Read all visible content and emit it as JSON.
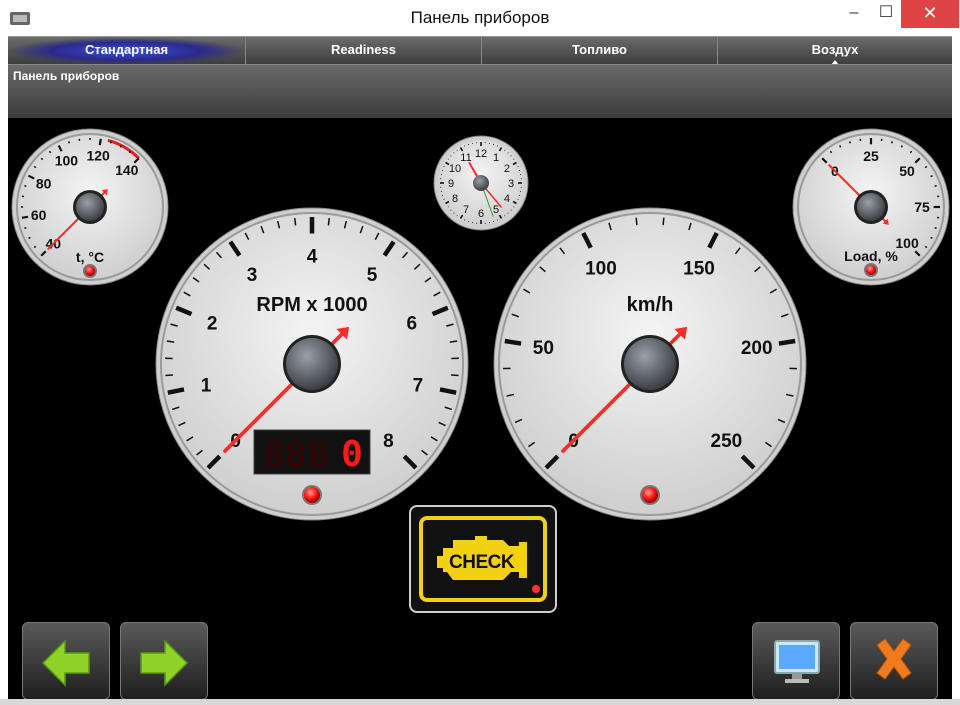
{
  "window": {
    "title": "Панель приборов",
    "icon": "app-icon",
    "minimize_label": "–",
    "maximize_label": "☐",
    "close_label": "✕"
  },
  "tabs": [
    {
      "label": "Стандартная",
      "active": true
    },
    {
      "label": "Readiness",
      "active": false
    },
    {
      "label": "Топливо",
      "active": false
    },
    {
      "label": "Воздух",
      "active": false
    }
  ],
  "subheader": {
    "label": "Панель приборов"
  },
  "gauges": {
    "temperature": {
      "label": "t, °C",
      "ticks": [
        "40",
        "60",
        "80",
        "100",
        "120",
        "140"
      ],
      "value": 40
    },
    "clock": {
      "ticks": [
        "12",
        "1",
        "2",
        "3",
        "4",
        "5",
        "6",
        "7",
        "8",
        "9",
        "10",
        "11"
      ]
    },
    "load": {
      "label": "Load, %",
      "ticks": [
        "0",
        "25",
        "50",
        "75",
        "100"
      ],
      "value": 0
    },
    "rpm": {
      "label": "RPM x 1000",
      "ticks": [
        "0",
        "1",
        "2",
        "3",
        "4",
        "5",
        "6",
        "7",
        "8"
      ],
      "value": 0,
      "digital_display": "0"
    },
    "speed": {
      "label": "km/h",
      "ticks": [
        "0",
        "50",
        "100",
        "150",
        "200",
        "250"
      ],
      "value": 0
    }
  },
  "check_engine": {
    "label": "CHECK",
    "icon": "engine-icon",
    "color": "#f2d012"
  },
  "buttons": {
    "back": {
      "icon": "arrow-left-icon"
    },
    "forward": {
      "icon": "arrow-right-icon"
    },
    "screen": {
      "icon": "monitor-icon"
    },
    "exit": {
      "icon": "close-x-icon"
    }
  },
  "colors": {
    "accent_red": "#ff2a2a",
    "tab_active": "#3a52e0",
    "arrow_green": "#8fd32a",
    "close_orange": "#f07a1e"
  }
}
